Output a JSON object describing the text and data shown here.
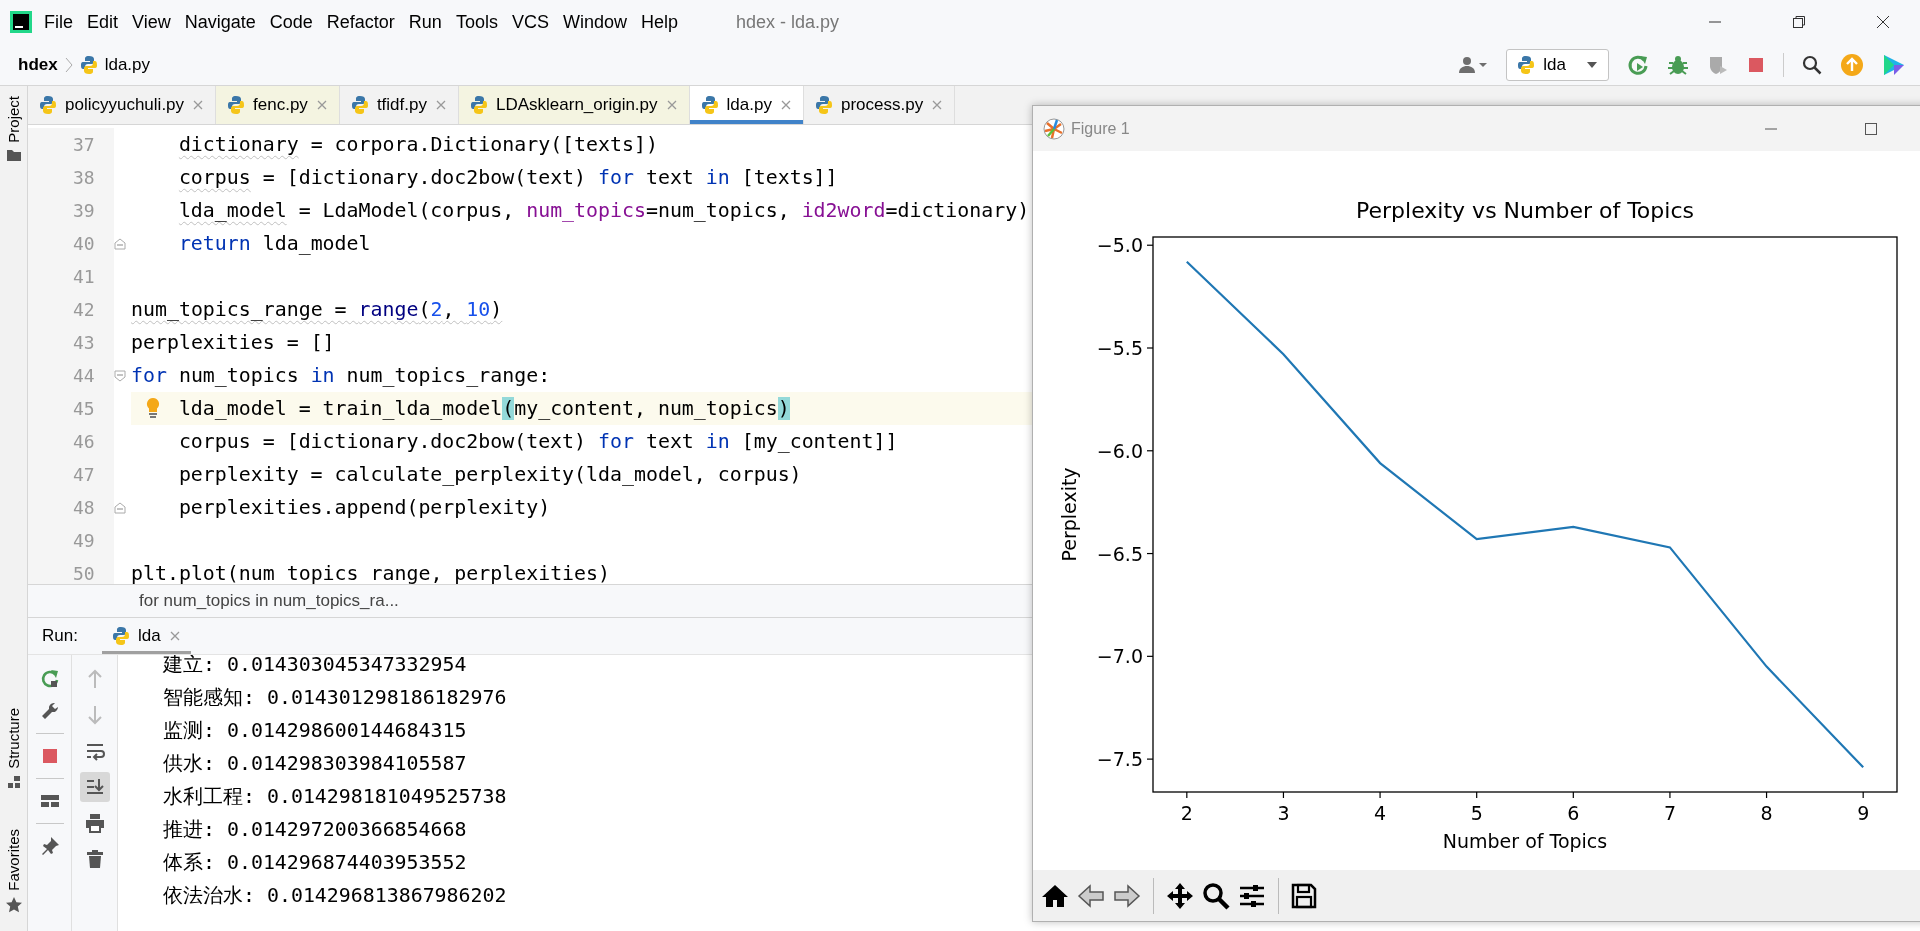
{
  "window": {
    "title": "hdex - lda.py"
  },
  "menu": [
    "File",
    "Edit",
    "View",
    "Navigate",
    "Code",
    "Refactor",
    "Run",
    "Tools",
    "VCS",
    "Window",
    "Help"
  ],
  "navigation": {
    "project": "hdex",
    "file": "lda.py",
    "run_config": "lda"
  },
  "side_tools": [
    "Project",
    "Structure",
    "Favorites"
  ],
  "tabs": [
    {
      "label": "policyyuchuli.py",
      "selected": false,
      "color": "#f2f2f2"
    },
    {
      "label": "fenc.py",
      "selected": false,
      "color": "#f4f4e1"
    },
    {
      "label": "tfidf.py",
      "selected": false,
      "color": "#f2f2f2"
    },
    {
      "label": "LDAsklearn_origin.py",
      "selected": false,
      "color": "#f4f4e1"
    },
    {
      "label": "lda.py",
      "selected": true,
      "color": "#ffffff"
    },
    {
      "label": "process.py",
      "selected": false,
      "color": "#f2f2f2"
    }
  ],
  "editor": {
    "lines": [
      {
        "number": "37",
        "indented": true,
        "fold_start": false,
        "fold_end": false,
        "current": false,
        "hint": false,
        "warning": false,
        "tokens": [
          {
            "kind": "weak",
            "text": "dictionary"
          },
          {
            "kind": "plain",
            "text": " = corpora.Dictionary([texts])"
          }
        ]
      },
      {
        "number": "38",
        "indented": true,
        "fold_start": false,
        "fold_end": false,
        "current": false,
        "hint": false,
        "warning": false,
        "tokens": [
          {
            "kind": "weak",
            "text": "corpus"
          },
          {
            "kind": "plain",
            "text": " = [dictionary.doc2bow(text) "
          },
          {
            "kind": "keyword",
            "text": "for"
          },
          {
            "kind": "plain",
            "text": " text "
          },
          {
            "kind": "keyword",
            "text": "in"
          },
          {
            "kind": "plain",
            "text": " [texts]]"
          }
        ]
      },
      {
        "number": "39",
        "indented": true,
        "fold_start": false,
        "fold_end": false,
        "current": false,
        "hint": false,
        "warning": false,
        "tokens": [
          {
            "kind": "weak",
            "text": "lda_model"
          },
          {
            "kind": "plain",
            "text": " = LdaModel(corpus, "
          },
          {
            "kind": "param",
            "text": "num_topics"
          },
          {
            "kind": "plain",
            "text": "=num_topics, "
          },
          {
            "kind": "param",
            "text": "id2word"
          },
          {
            "kind": "plain",
            "text": "=dictionary)"
          }
        ]
      },
      {
        "number": "40",
        "indented": true,
        "fold_start": false,
        "fold_end": true,
        "current": false,
        "hint": false,
        "warning": false,
        "tokens": [
          {
            "kind": "keyword",
            "text": "return"
          },
          {
            "kind": "plain",
            "text": " lda_model"
          }
        ]
      },
      {
        "number": "41",
        "indented": false,
        "fold_start": false,
        "fold_end": false,
        "current": false,
        "hint": false,
        "warning": false
      },
      {
        "number": "42",
        "indented": false,
        "fold_start": false,
        "fold_end": false,
        "current": false,
        "hint": false,
        "warning": true,
        "tokens": [
          {
            "kind": "plain",
            "text": "num_topics_range = "
          },
          {
            "kind": "builtin",
            "text": "range"
          },
          {
            "kind": "plain",
            "text": "("
          },
          {
            "kind": "number",
            "text": "2"
          },
          {
            "kind": "plain",
            "text": ", "
          },
          {
            "kind": "number",
            "text": "10"
          },
          {
            "kind": "plain",
            "text": ")"
          }
        ]
      },
      {
        "number": "43",
        "indented": false,
        "fold_start": false,
        "fold_end": false,
        "current": false,
        "hint": false,
        "warning": false,
        "tokens": [
          {
            "kind": "plain",
            "text": "perplexities = []"
          }
        ]
      },
      {
        "number": "44",
        "indented": false,
        "fold_start": true,
        "fold_end": false,
        "current": false,
        "hint": false,
        "warning": false,
        "tokens": [
          {
            "kind": "keyword",
            "text": "for"
          },
          {
            "kind": "plain",
            "text": " num_topics "
          },
          {
            "kind": "keyword",
            "text": "in"
          },
          {
            "kind": "plain",
            "text": " num_topics_range:"
          }
        ]
      },
      {
        "number": "45",
        "indented": true,
        "fold_start": false,
        "fold_end": false,
        "current": true,
        "hint": true,
        "warning": false,
        "tokens": [
          {
            "kind": "plain",
            "text": "lda_model = train_lda_model"
          },
          {
            "kind": "match",
            "text": "("
          },
          {
            "kind": "plain",
            "text": "my_content, num_topics"
          },
          {
            "kind": "match",
            "text": ")"
          }
        ]
      },
      {
        "number": "46",
        "indented": true,
        "fold_start": false,
        "fold_end": false,
        "current": false,
        "hint": false,
        "warning": false,
        "tokens": [
          {
            "kind": "plain",
            "text": "corpus = [dictionary.doc2bow(text) "
          },
          {
            "kind": "keyword",
            "text": "for"
          },
          {
            "kind": "plain",
            "text": " text "
          },
          {
            "kind": "keyword",
            "text": "in"
          },
          {
            "kind": "plain",
            "text": " [my_content]]"
          }
        ]
      },
      {
        "number": "47",
        "indented": true,
        "fold_start": false,
        "fold_end": false,
        "current": false,
        "hint": false,
        "warning": false,
        "tokens": [
          {
            "kind": "plain",
            "text": "perplexity = calculate_perplexity(lda_model, corpus)"
          }
        ]
      },
      {
        "number": "48",
        "indented": true,
        "fold_start": false,
        "fold_end": true,
        "current": false,
        "hint": false,
        "warning": false,
        "tokens": [
          {
            "kind": "plain",
            "text": "perplexities.append(perplexity)"
          }
        ]
      },
      {
        "number": "49",
        "indented": false,
        "fold_start": false,
        "fold_end": false,
        "current": false,
        "hint": false,
        "warning": false
      },
      {
        "number": "50",
        "indented": false,
        "fold_start": false,
        "fold_end": false,
        "current": false,
        "hint": false,
        "warning": false,
        "tokens": [
          {
            "kind": "plain",
            "text": "plt.plot(num_topics_range, perplexities)"
          }
        ]
      }
    ]
  },
  "breadcrumb": "for num_topics in num_topics_ra...",
  "run_panel": {
    "label": "Run:",
    "tab": "lda",
    "left_tools": [
      {
        "kind": "rerun"
      },
      {
        "kind": "wrench"
      },
      {
        "kind": "stop"
      },
      {
        "kind": "layout"
      },
      {
        "kind": "pin"
      }
    ],
    "right_tools": [
      {
        "kind": "up",
        "disabled": true,
        "selected": false
      },
      {
        "kind": "down",
        "disabled": true,
        "selected": false
      },
      {
        "kind": "wrap",
        "disabled": false,
        "selected": false
      },
      {
        "kind": "scroll_end",
        "disabled": false,
        "selected": true
      },
      {
        "kind": "print",
        "disabled": false,
        "selected": false
      },
      {
        "kind": "trash",
        "disabled": false,
        "selected": false
      }
    ],
    "output": [
      "建立: 0.014303045347332954",
      "智能感知: 0.014301298186182976",
      "监测: 0.014298600144684315",
      "供水: 0.014298303984105587",
      "水利工程: 0.014298181049525738",
      "推进: 0.014297200366854668",
      "体系: 0.014296874403953552",
      "依法治水: 0.014296813867986202"
    ]
  },
  "figure": {
    "title": "Figure 1",
    "chart_data": {
      "type": "line",
      "title": "Perplexity vs Number of Topics",
      "xlabel": "Number of Topics",
      "ylabel": "Perplexity",
      "x": [
        2,
        3,
        4,
        5,
        6,
        7,
        8,
        9
      ],
      "series": [
        {
          "color": "#1f77b4",
          "values": [
            -5.08,
            -5.53,
            -6.06,
            -6.43,
            -6.37,
            -6.47,
            -7.05,
            -7.54
          ]
        }
      ],
      "xlim": [
        1.65,
        9.35
      ],
      "ylim": [
        -7.66,
        -4.96
      ],
      "xticks": [
        2,
        3,
        4,
        5,
        6,
        7,
        8,
        9
      ],
      "yticks": [
        {
          "value": -5.0,
          "label": "−5.0"
        },
        {
          "value": -5.5,
          "label": "−5.5"
        },
        {
          "value": -6.0,
          "label": "−6.0"
        },
        {
          "value": -6.5,
          "label": "−6.5"
        },
        {
          "value": -7.0,
          "label": "−7.0"
        },
        {
          "value": -7.5,
          "label": "−7.5"
        }
      ]
    }
  }
}
